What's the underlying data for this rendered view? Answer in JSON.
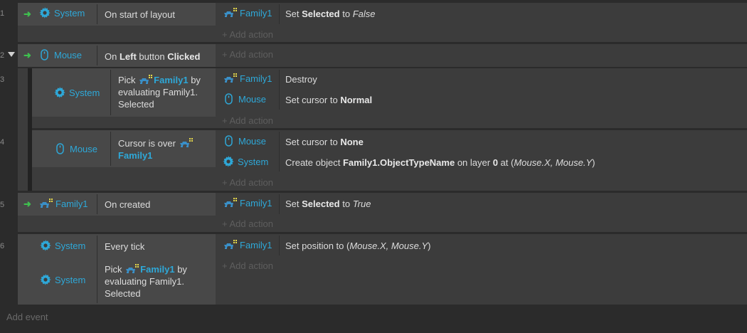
{
  "line_numbers": [
    "1",
    "2",
    "3",
    "4",
    "5",
    "6"
  ],
  "events": [
    {
      "num": "1",
      "conditions": [
        {
          "object": "System",
          "icon": "gear-icon",
          "text": "On start of layout"
        }
      ],
      "actions": [
        {
          "object": "Family1",
          "icon": "family-icon",
          "pre": "Set ",
          "bold": "Selected",
          "mid": " to ",
          "italic": "False"
        }
      ],
      "add_action": "+ Add action"
    },
    {
      "num": "2",
      "conditions": [
        {
          "object": "Mouse",
          "icon": "mouse-icon",
          "pre": "On ",
          "bold1": "Left",
          "mid": " button ",
          "bold2": "Clicked"
        }
      ],
      "add_action": "+ Add action"
    },
    {
      "num": "3",
      "conditions": [
        {
          "object": "System",
          "icon": "gear-icon",
          "pre": "Pick ",
          "family": "Family1",
          "post1": " by",
          "post2": "evaluating Family1.",
          "post3": "Selected"
        }
      ],
      "actions": [
        {
          "object": "Family1",
          "icon": "family-icon",
          "text": "Destroy"
        },
        {
          "object": "Mouse",
          "icon": "mouse-icon",
          "pre": "Set cursor to ",
          "bold": "Normal"
        }
      ],
      "add_action": "+ Add action"
    },
    {
      "num": "4",
      "conditions": [
        {
          "object": "Mouse",
          "icon": "mouse-icon",
          "pre": "Cursor is over",
          "family": "Family1"
        }
      ],
      "actions": [
        {
          "object": "Mouse",
          "icon": "mouse-icon",
          "pre": "Set cursor to ",
          "bold": "None"
        },
        {
          "object": "System",
          "icon": "gear-icon",
          "pre": "Create object ",
          "bold": "Family1.ObjectTypeName",
          "mid": " on layer ",
          "bold2": "0",
          "mid2": " at (",
          "italic": "Mouse.X, Mouse.Y",
          "end": ")"
        }
      ],
      "add_action": "+ Add action"
    },
    {
      "num": "5",
      "conditions": [
        {
          "object": "Family1",
          "icon": "family-icon",
          "text": "On created"
        }
      ],
      "actions": [
        {
          "object": "Family1",
          "icon": "family-icon",
          "pre": "Set ",
          "bold": "Selected",
          "mid": " to ",
          "italic": "True"
        }
      ],
      "add_action": "+ Add action"
    },
    {
      "num": "6",
      "conditions": [
        {
          "object": "System",
          "icon": "gear-icon",
          "text": "Every tick"
        },
        {
          "object": "System",
          "icon": "gear-icon",
          "pre": "Pick ",
          "family": "Family1",
          "post1": " by",
          "post2": "evaluating Family1.",
          "post3": "Selected"
        }
      ],
      "actions": [
        {
          "object": "Family1",
          "icon": "family-icon",
          "pre": "Set position to (",
          "italic": "Mouse.X, Mouse.Y",
          "end": ")"
        }
      ],
      "add_action": "+ Add action"
    }
  ],
  "add_event": "Add event",
  "colors": {
    "object_blue": "#2ea8d8",
    "trigger_green": "#3fbf4f",
    "event_bg": "#3c3c3c",
    "condition_bg": "#484848"
  }
}
